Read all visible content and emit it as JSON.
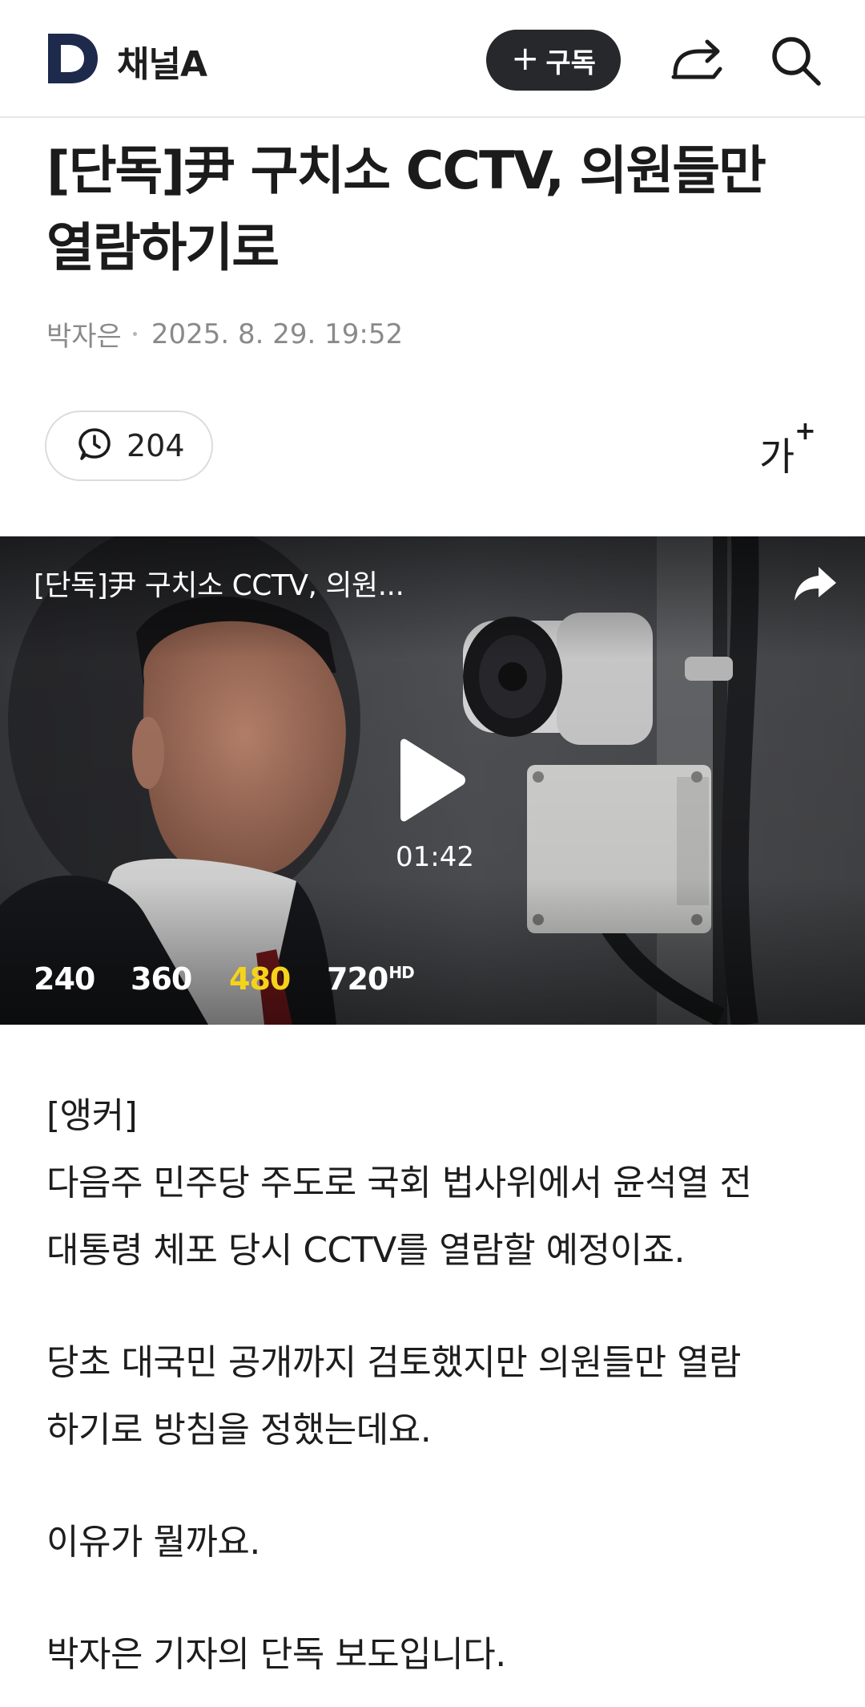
{
  "header": {
    "logo_letter": "D",
    "channel_name": "채널A",
    "subscribe_label": "구독",
    "subscribe_plus": "+"
  },
  "article": {
    "title": "[단독]尹 구치소 CCTV, 의원들만 열람하기로",
    "author": "박자은",
    "datetime": "2025. 8. 29. 19:52",
    "comment_count": "204",
    "font_size_label": "가",
    "font_size_sup": "+"
  },
  "video": {
    "title": "[단독]尹 구치소 CCTV, 의원...",
    "duration": "01:42",
    "qualities": [
      "240",
      "360",
      "480",
      "720"
    ],
    "hd_badge": "HD",
    "selected_quality": "480"
  },
  "body": {
    "p1_line1": "[앵커]",
    "p1_line2": "다음주 민주당 주도로 국회 법사위에서 윤석열 전",
    "p1_line3": "대통령 체포 당시 CCTV를 열람할 예정이죠.",
    "p2_line1": "당초 대국민 공개까지 검토했지만 의원들만 열람",
    "p2_line2": "하기로 방침을 정했는데요.",
    "p3": "이유가 뭘까요.",
    "p4": "박자은 기자의 단독 보도입니다."
  },
  "colors": {
    "logo_navy": "#1d2a4c",
    "subscribe_bg": "#26282c",
    "active_quality": "#f5d31a",
    "meta_gray": "#8a8a8a"
  },
  "icons": {
    "share": "share-icon",
    "search": "search-icon",
    "comment": "comment-icon",
    "play": "play-icon",
    "video_share": "share-arrow-icon"
  }
}
